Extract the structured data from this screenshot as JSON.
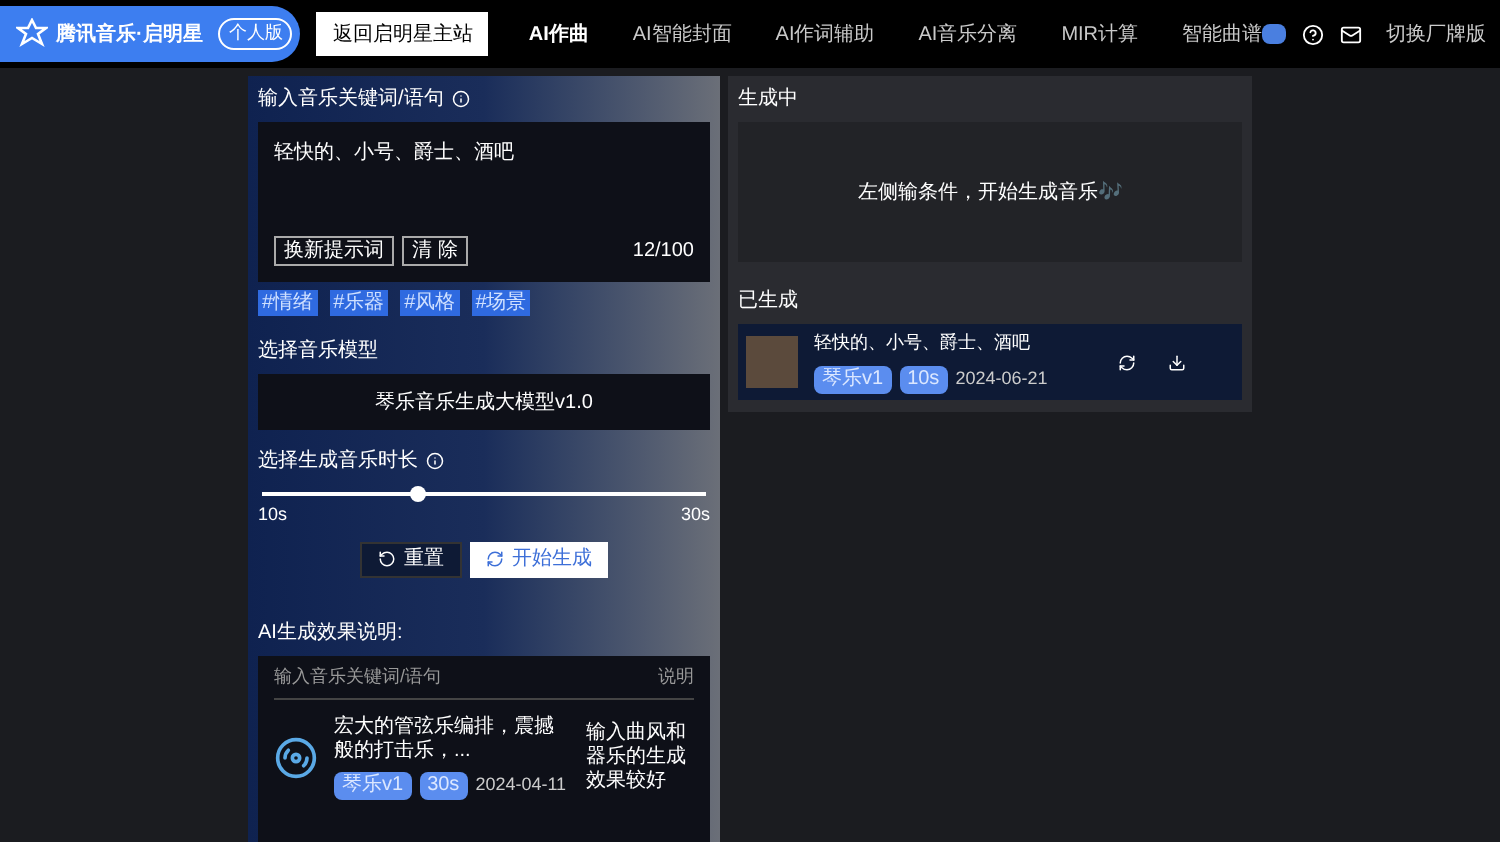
{
  "header": {
    "logo": "腾讯音乐·启明星",
    "edition": "个人版",
    "back_link": "返回启明星主站",
    "nav": [
      {
        "label": "AI作曲",
        "selected": true
      },
      {
        "label": "AI智能封面",
        "selected": false
      },
      {
        "label": "AI作词辅助",
        "selected": false
      },
      {
        "label": "AI音乐分离",
        "selected": false
      },
      {
        "label": "MIR计算",
        "selected": false
      },
      {
        "label": "智能曲谱",
        "selected": false
      }
    ],
    "switch_label": "切换厂牌版"
  },
  "input": {
    "title": "输入音乐关键词/语句",
    "value": "轻快的、小号、爵士、酒吧",
    "buttons": [
      "换新提示词",
      "清 除"
    ],
    "count": "12/100",
    "tags": [
      "#情绪",
      "#乐器",
      "#风格",
      "#场景"
    ]
  },
  "model": {
    "title": "选择音乐模型",
    "value": "琴乐音乐生成大模型v1.0"
  },
  "duration": {
    "title": "选择生成音乐时长",
    "level": 0.35,
    "min": "10s",
    "max": "30s"
  },
  "actions": {
    "reset": "重置",
    "start": "开始生成"
  },
  "examples": {
    "title": "AI生成效果说明:",
    "columns": [
      "输入音乐关键词/语句",
      "说明"
    ],
    "rows": [
      {
        "text": "宏大的管弦乐编排，震撼般的打击乐，...",
        "model": "琴乐v1",
        "length": "30s",
        "date": "2024-04-11",
        "note": "输入曲风和器乐的生成效果较好"
      }
    ]
  },
  "generating": {
    "title": "生成中",
    "message": "左侧输条件，开始生成音乐🎶"
  },
  "generated": {
    "title": "已生成",
    "items": [
      {
        "text": "轻快的、小号、爵士、酒吧",
        "model": "琴乐v1",
        "length": "10s",
        "date": "2024-06-21"
      }
    ]
  }
}
